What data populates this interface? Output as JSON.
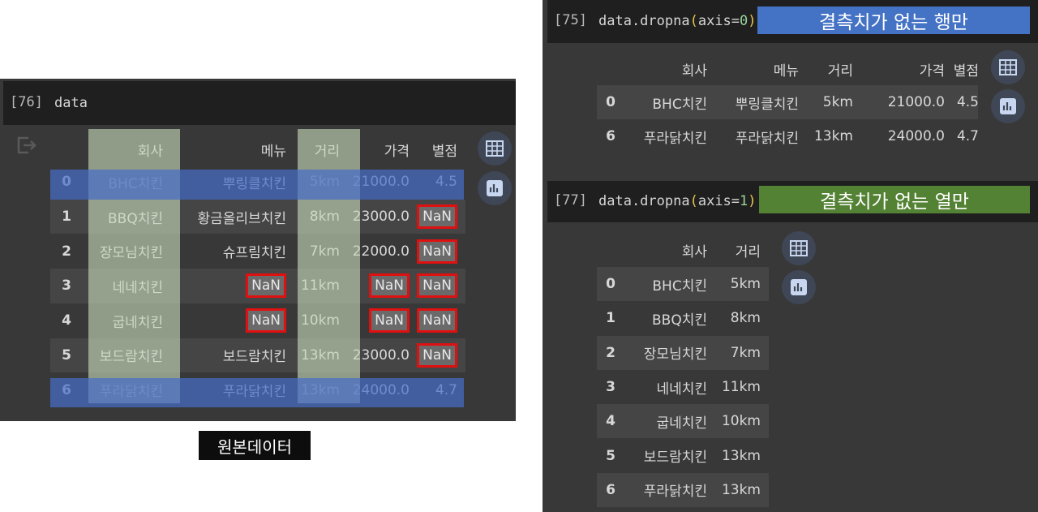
{
  "left": {
    "cell_number": "[76]",
    "code": "data",
    "headers": [
      "",
      "회사",
      "메뉴",
      "거리",
      "가격",
      "별점"
    ],
    "rows": [
      [
        "0",
        "BHC치킨",
        "뿌링클치킨",
        "5km",
        "21000.0",
        "4.5"
      ],
      [
        "1",
        "BBQ치킨",
        "황금올리브치킨",
        "8km",
        "23000.0",
        "NaN"
      ],
      [
        "2",
        "장모님치킨",
        "슈프림치킨",
        "7km",
        "22000.0",
        "NaN"
      ],
      [
        "3",
        "네네치킨",
        "NaN",
        "11km",
        "NaN",
        "NaN"
      ],
      [
        "4",
        "굽네치킨",
        "NaN",
        "10km",
        "NaN",
        "NaN"
      ],
      [
        "5",
        "보드람치킨",
        "보드람치킨",
        "13km",
        "23000.0",
        "NaN"
      ],
      [
        "6",
        "푸라닭치킨",
        "푸라닭치킨",
        "13km",
        "24000.0",
        "4.7"
      ]
    ],
    "caption": "원본데이터",
    "output_icon": "output-collapse-icon",
    "table_icon": "table-icon",
    "chart_icon": "bar-chart-icon"
  },
  "top_right": {
    "cell_number": "[75]",
    "code_prefix": "data.dropna",
    "code_open": "(",
    "code_arg": "axis=",
    "code_num": "0",
    "code_close": ")",
    "label": "결측치가 없는 행만",
    "label_color": "#4472c4",
    "headers": [
      "",
      "회사",
      "메뉴",
      "거리",
      "가격",
      "별점"
    ],
    "rows": [
      [
        "0",
        "BHC치킨",
        "뿌링클치킨",
        "5km",
        "21000.0",
        "4.5"
      ],
      [
        "6",
        "푸라닭치킨",
        "푸라닭치킨",
        "13km",
        "24000.0",
        "4.7"
      ]
    ]
  },
  "bottom_right": {
    "cell_number": "[77]",
    "code_prefix": "data.dropna",
    "code_open": "(",
    "code_arg": "axis=",
    "code_num": "1",
    "code_close": ")",
    "label": "결측치가 없는 열만",
    "label_color": "#548235",
    "headers": [
      "",
      "회사",
      "거리"
    ],
    "rows": [
      [
        "0",
        "BHC치킨",
        "5km"
      ],
      [
        "1",
        "BBQ치킨",
        "8km"
      ],
      [
        "2",
        "장모님치킨",
        "7km"
      ],
      [
        "3",
        "네네치킨",
        "11km"
      ],
      [
        "4",
        "굽네치킨",
        "10km"
      ],
      [
        "5",
        "보드람치킨",
        "13km"
      ],
      [
        "6",
        "푸라닭치킨",
        "13km"
      ]
    ]
  },
  "colors": {
    "nan_border": "#e01010",
    "row_highlight": "#466ec8",
    "column_highlight": "#c6d8ba"
  }
}
